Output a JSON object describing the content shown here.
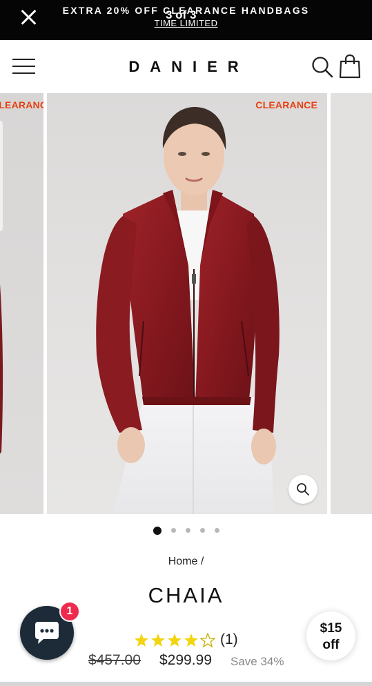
{
  "promo": {
    "line1": "EXTRA 20% OFF CLEARANCE HANDBAGS",
    "counter": "3 of 3",
    "line2": "TIME LIMITED"
  },
  "header": {
    "logo": "DANIER",
    "icons": [
      "hamburger-menu-icon",
      "search-icon",
      "shopping-bag-icon"
    ]
  },
  "gallery": {
    "slides": [
      {
        "tag": "CLEARANCE"
      },
      {
        "tag": "CLEARANCE"
      },
      {
        "tag": ""
      }
    ],
    "dots": {
      "total": 5,
      "active": 1
    }
  },
  "product": {
    "breadcrumb": "Home /",
    "title": "CHAIA",
    "rating": {
      "stars": 4,
      "max": 5,
      "count_label": "(1)"
    },
    "price_old": "$457.00",
    "price_new": "$299.99",
    "save": "Save 34%"
  },
  "chat": {
    "badge": "1"
  },
  "offer": {
    "line1": "$15",
    "line2": "off"
  },
  "colors": {
    "promo_bg": "#050505",
    "clearance_tag": "#e64011",
    "jacket": "#8e1c22",
    "star": "#f2d40f",
    "chat_bg": "#1d2b38",
    "badge": "#ee2b4e"
  }
}
